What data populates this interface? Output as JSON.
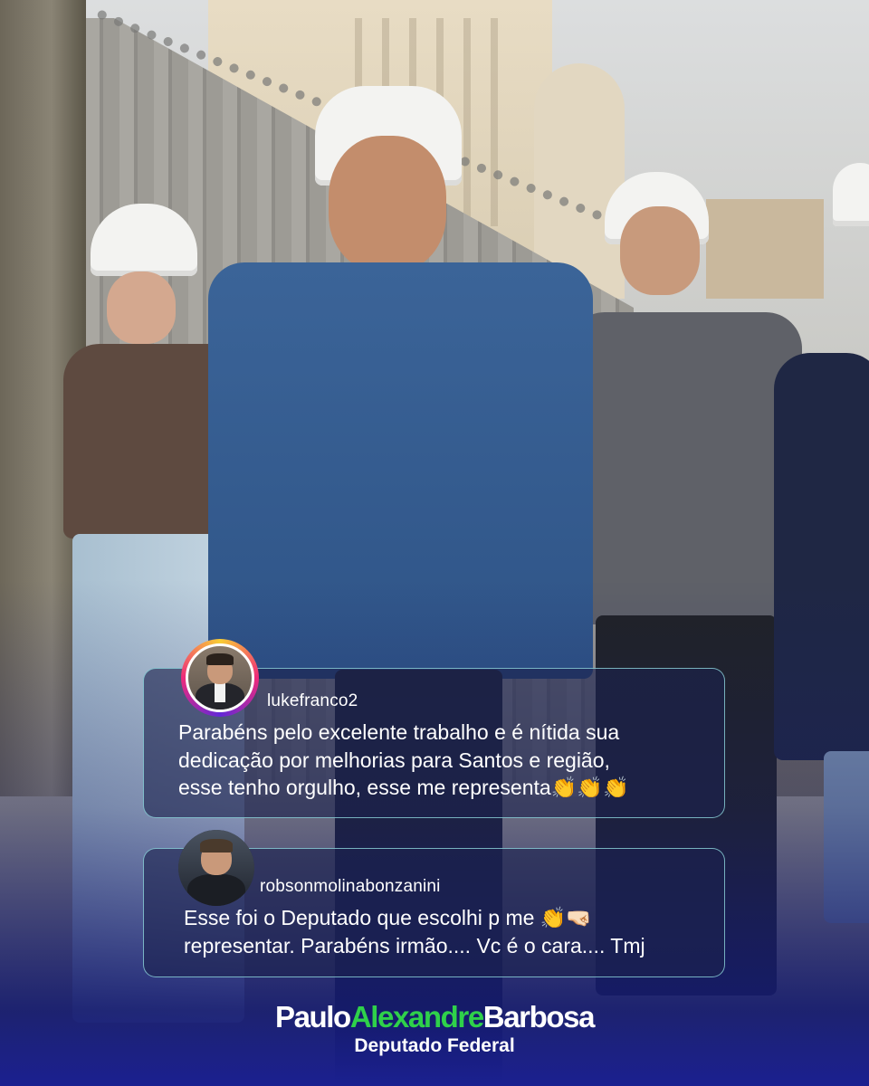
{
  "comments": [
    {
      "username": "lukefranco2",
      "text": "Parabéns pelo excelente trabalho e é nítida sua\ndedicação  por melhorias para Santos e região,\nesse tenho orgulho, esse me representa👏👏👏",
      "avatar": "profile-photo-with-story-ring"
    },
    {
      "username": "robsonmolinabonzanini",
      "text": "Esse foi o Deputado que escolhi p me 👏🤜🏻\nrepresentar. Parabéns irmão.... Vc é o cara.... Tmj",
      "avatar": "profile-photo"
    }
  ],
  "signature": {
    "first": "Paulo",
    "middle": "Alexandre",
    "last": "Barbosa",
    "role": "Deputado Federal",
    "accent_color": "#2fd14a"
  },
  "colors": {
    "card_border": "#96e1e6",
    "bottom_gradient": "#1b2090"
  }
}
